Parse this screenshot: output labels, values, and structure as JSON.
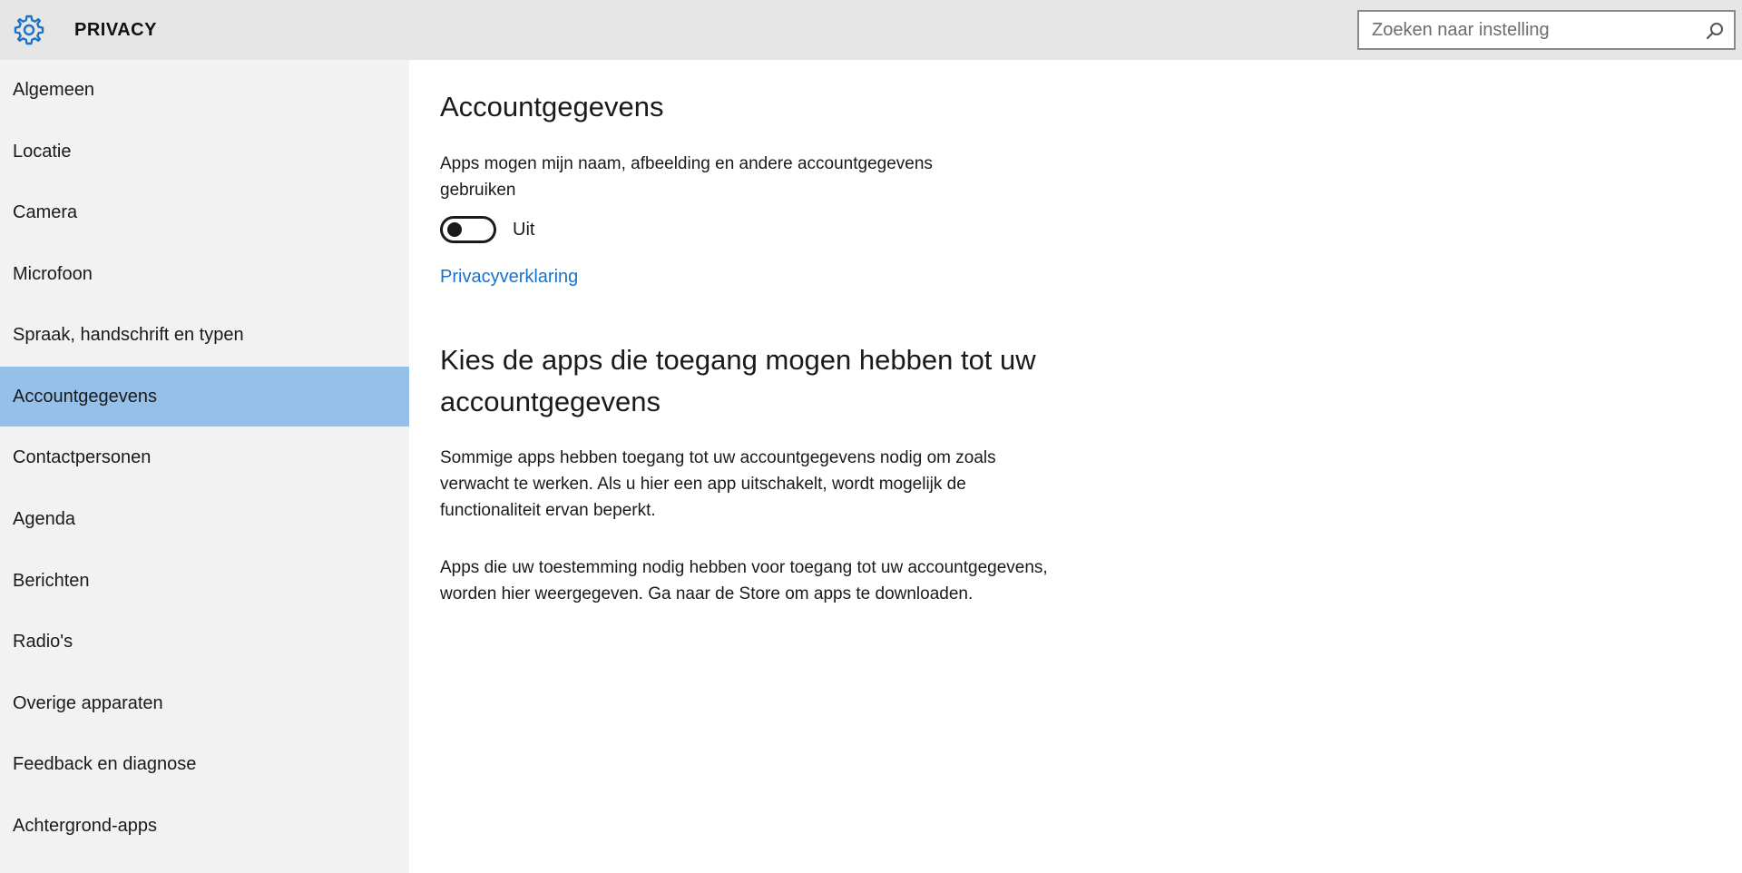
{
  "header": {
    "title": "PRIVACY",
    "search_placeholder": "Zoeken naar instelling",
    "icon": "gear-icon",
    "accent_color": "#1b72c7"
  },
  "sidebar": {
    "active_index": 5,
    "active_color": "#94c0ea",
    "items": [
      {
        "label": "Algemeen"
      },
      {
        "label": "Locatie"
      },
      {
        "label": "Camera"
      },
      {
        "label": "Microfoon"
      },
      {
        "label": "Spraak, handschrift en typen"
      },
      {
        "label": "Accountgegevens"
      },
      {
        "label": "Contactpersonen"
      },
      {
        "label": "Agenda"
      },
      {
        "label": "Berichten"
      },
      {
        "label": "Radio's"
      },
      {
        "label": "Overige apparaten"
      },
      {
        "label": "Feedback en diagnose"
      },
      {
        "label": "Achtergrond-apps"
      }
    ]
  },
  "main": {
    "title": "Accountgegevens",
    "setting_desc": "Apps mogen mijn naam, afbeelding en andere accountgegevens gebruiken",
    "toggle_state": "Uit",
    "privacy_link": "Privacyverklaring",
    "heading2": "Kies de apps die toegang mogen hebben tot uw accountgegevens",
    "para1": "Sommige apps hebben toegang tot uw accountgegevens nodig om zoals verwacht te werken. Als u hier een app uitschakelt, wordt mogelijk de functionaliteit ervan beperkt.",
    "para2": "Apps die uw toestemming nodig hebben voor toegang tot uw accountgegevens, worden hier weergegeven. Ga naar de Store om apps te downloaden."
  }
}
